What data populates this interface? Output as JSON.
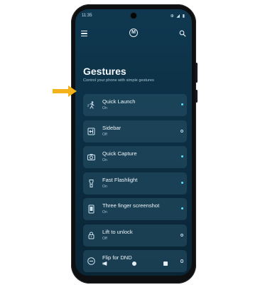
{
  "status_bar": {
    "time": "11:35",
    "icons": "⊕ ◢ ▮"
  },
  "header": {
    "title": "Gestures",
    "subtitle": "Control your phone with simple gestures",
    "logo": "M"
  },
  "gestures": [
    {
      "label": "Quick Launch",
      "status": "On",
      "icon": "quick-launch-icon",
      "on": true
    },
    {
      "label": "Sidebar",
      "status": "Off",
      "icon": "sidebar-icon",
      "on": false
    },
    {
      "label": "Quick Capture",
      "status": "On",
      "icon": "camera-icon",
      "on": true
    },
    {
      "label": "Fast Flashlight",
      "status": "On",
      "icon": "flashlight-icon",
      "on": true
    },
    {
      "label": "Three finger screenshot",
      "status": "On",
      "icon": "screenshot-icon",
      "on": true
    },
    {
      "label": "Lift to unlock",
      "status": "Off",
      "icon": "lock-icon",
      "on": false
    },
    {
      "label": "Flip for DND",
      "status": "Off",
      "icon": "dnd-icon",
      "on": false
    }
  ],
  "colors": {
    "accent": "#5fe0ff",
    "arrow": "#f3b21a",
    "background": "#0c2f43"
  }
}
